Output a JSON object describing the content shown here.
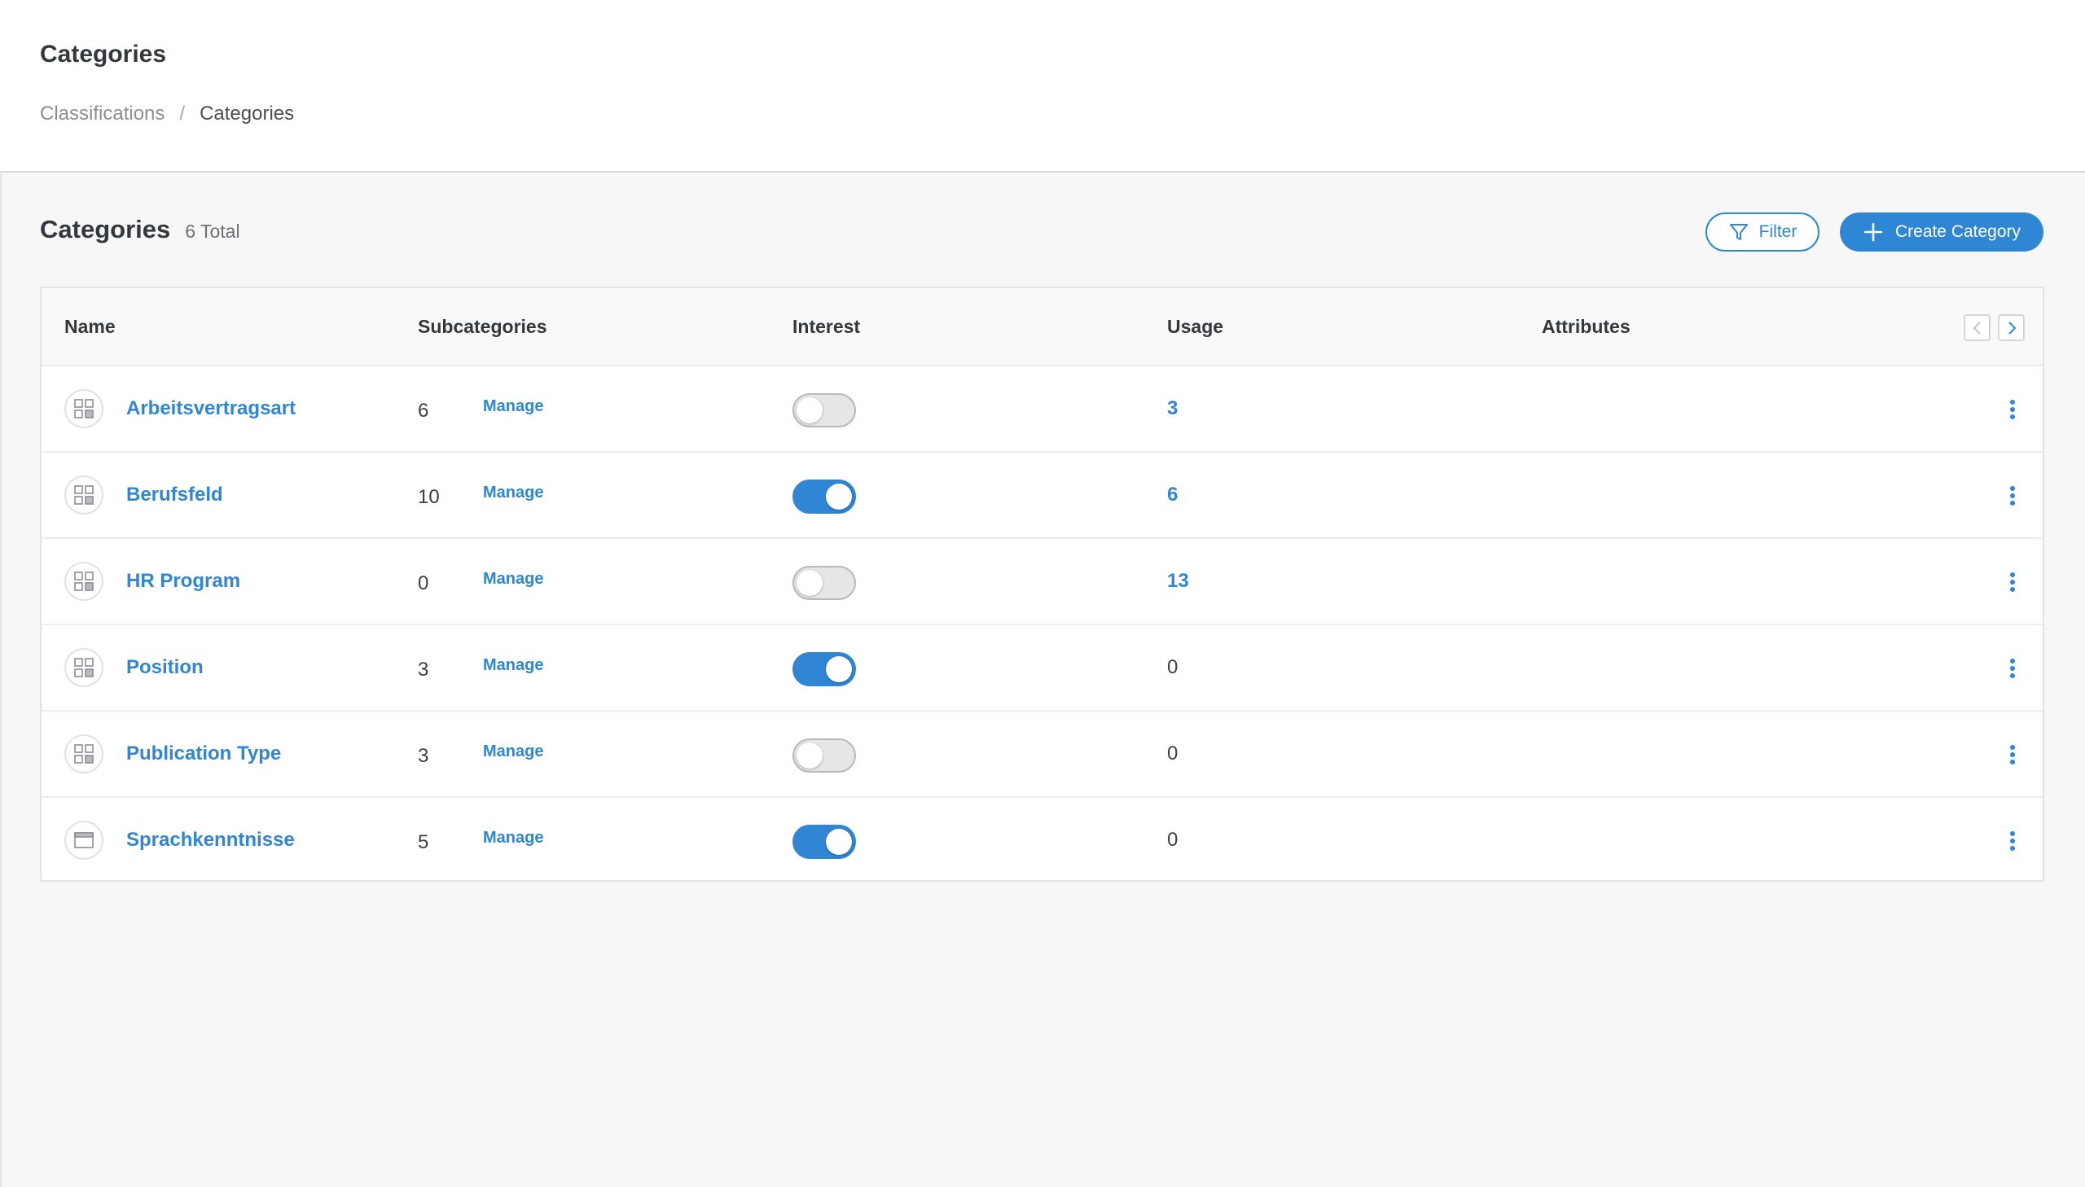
{
  "header": {
    "title": "Categories",
    "breadcrumb": {
      "parent": "Classifications",
      "separator": "/",
      "current": "Categories"
    }
  },
  "section": {
    "title": "Categories",
    "count_label": "6 Total"
  },
  "toolbar": {
    "filter_label": "Filter",
    "create_label": "Create Category",
    "accent_color": "#2f86d4"
  },
  "table": {
    "columns": {
      "name": "Name",
      "subcategories": "Subcategories",
      "interest": "Interest",
      "usage": "Usage",
      "attributes": "Attributes"
    },
    "rows": [
      {
        "icon": "grid-icon",
        "name": "Arbeitsvertragsart",
        "subcategories": "6",
        "manage": "Manage",
        "interest": "off",
        "usage": "3",
        "usage_link": true
      },
      {
        "icon": "grid-icon",
        "name": "Berufsfeld",
        "subcategories": "10",
        "manage": "Manage",
        "interest": "on",
        "usage": "6",
        "usage_link": true
      },
      {
        "icon": "grid-icon",
        "name": "HR Program",
        "subcategories": "0",
        "manage": "Manage",
        "interest": "off",
        "usage": "13",
        "usage_link": true
      },
      {
        "icon": "grid-icon",
        "name": "Position",
        "subcategories": "3",
        "manage": "Manage",
        "interest": "on",
        "usage": "0",
        "usage_link": false
      },
      {
        "icon": "grid-icon",
        "name": "Publication Type",
        "subcategories": "3",
        "manage": "Manage",
        "interest": "off",
        "usage": "0",
        "usage_link": false
      },
      {
        "icon": "window-icon",
        "name": "Sprachkenntnisse",
        "subcategories": "5",
        "manage": "Manage",
        "interest": "on",
        "usage": "0",
        "usage_link": false
      }
    ]
  }
}
